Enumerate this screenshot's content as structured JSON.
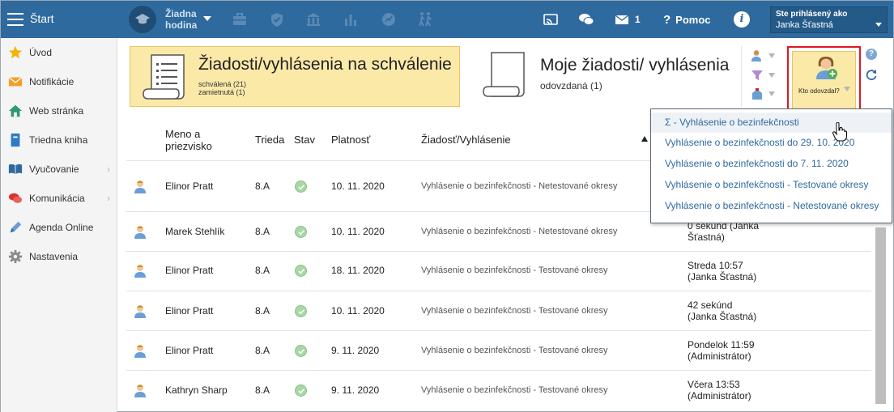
{
  "topbar": {
    "start_label": "Štart",
    "no_lesson_line1": "Žiadna",
    "no_lesson_line2": "hodina",
    "messages_count": "1",
    "help_label": "Pomoc",
    "user_line1": "Ste prihlásený ako",
    "user_line2": "Janka Šťastná",
    "icons": [
      "briefcase-icon",
      "shield-icon",
      "school-building-icon",
      "bar-chart-icon",
      "chart-circle-icon",
      "walking-people-icon",
      "cast-icon",
      "chat-icon",
      "mail-icon",
      "info-icon"
    ]
  },
  "sidebar": {
    "items": [
      {
        "label": "Úvod",
        "icon": "star-icon"
      },
      {
        "label": "Notifikácie",
        "icon": "envelope-icon"
      },
      {
        "label": "Web stránka",
        "icon": "house-icon"
      },
      {
        "label": "Triedna kniha",
        "icon": "book-icon"
      },
      {
        "label": "Vyučovanie",
        "icon": "open-book-icon"
      },
      {
        "label": "Komunikácia",
        "icon": "chat-bubbles-icon"
      },
      {
        "label": "Agenda Online",
        "icon": "pencil-icon"
      },
      {
        "label": "Nastavenia",
        "icon": "gear-icon"
      }
    ]
  },
  "cards": {
    "requests_title": "Žiadosti/vyhlásenia na schválenie",
    "requests_approved": "schválená (21)",
    "requests_rejected": "zamietnutá (1)",
    "my_title": "Moje žiadosti/ vyhlásenia",
    "my_submitted": "odovzdaná (1)",
    "who_label": "Kto odovzdal?"
  },
  "table": {
    "headers": {
      "name": "Meno a priezvisko",
      "class": "Trieda",
      "state": "Stav",
      "validity": "Platnosť",
      "request": "Žiadosť/Vyhlásenie"
    },
    "rows": [
      {
        "name": "Elinor Pratt",
        "class": "8.A",
        "validity": "10. 11. 2020",
        "type": "Vyhlásenie o bezinfekčnosti - Netestované okresy",
        "time1": "",
        "time2": ""
      },
      {
        "name": "Marek Stehlík",
        "class": "8.A",
        "validity": "10. 11. 2020",
        "type": "Vyhlásenie o bezinfekčnosti - Netestované okresy",
        "time1": "0 sekúnd (Janka",
        "time2": "Šťastná)"
      },
      {
        "name": "Elinor Pratt",
        "class": "8.A",
        "validity": "18. 11. 2020",
        "type": "Vyhlásenie o bezinfekčnosti - Testované okresy",
        "time1": "Streda 10:57",
        "time2": "(Janka Šťastná)"
      },
      {
        "name": "Elinor Pratt",
        "class": "8.A",
        "validity": "10. 11. 2020",
        "type": "Vyhlásenie o bezinfekčnosti - Testované okresy",
        "time1": "42 sekúnd",
        "time2": "(Janka Šťastná)"
      },
      {
        "name": "Elinor Pratt",
        "class": "8.A",
        "validity": "9. 11. 2020",
        "type": "Vyhlásenie o bezinfekčnosti - Testované okresy",
        "time1": "Pondelok 11:59",
        "time2": "(Administrátor)"
      },
      {
        "name": "Kathryn Sharp",
        "class": "8.A",
        "validity": "9. 11. 2020",
        "type": "Vyhlásenie o bezinfekčnosti - Testované okresy",
        "time1": "Včera 13:53",
        "time2": "(Administrátor)"
      }
    ]
  },
  "dropdown": {
    "items": [
      "Σ - Vyhlásenie o bezinfekčnosti",
      "Vyhlásenie o bezinfekčnosti do 29. 10. 2020",
      "Vyhlásenie o bezinfekčnosti do 7. 11. 2020",
      "Vyhlásenie o bezinfekčnosti - Testované okresy",
      "Vyhlásenie o bezinfekčnosti - Netestované okresy"
    ]
  },
  "colors": {
    "topbar": "#2f6a9e",
    "card_highlight": "#fbe9a8",
    "link": "#2f6a9e",
    "highlight_border": "#e0191e"
  }
}
